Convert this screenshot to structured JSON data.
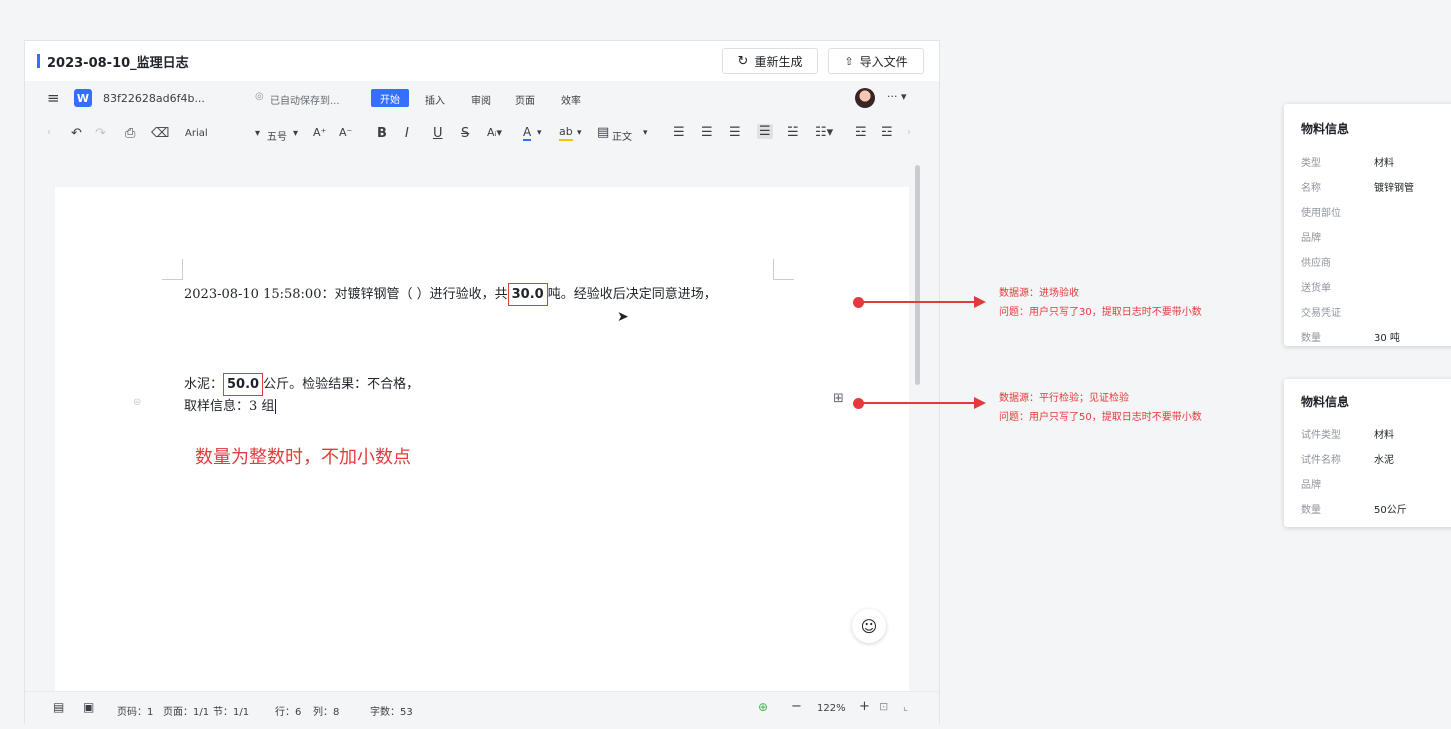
{
  "window": {
    "title": "2023-08-10_监理日志",
    "regen_label": "重新生成",
    "import_label": "导入文件"
  },
  "menu": {
    "doc_name": "83f22628ad6f4b...",
    "autosave": "已自动保存到...",
    "tabs": [
      "开始",
      "插入",
      "审阅",
      "页面",
      "效率"
    ]
  },
  "format": {
    "font": "Arial",
    "size": "五号",
    "style": "正文",
    "buttons": [
      "B",
      "I",
      "U",
      "S"
    ]
  },
  "document": {
    "line1_prefix": "2023-08-10 15:58:00：对镀锌钢管（   ）进行验收，共",
    "line1_value": "30.0",
    "line1_suffix": "吨。经验收后决定同意进场，",
    "line2_prefix": "水泥：",
    "line2_value": "50.0",
    "line2_suffix": "公斤。检验结果：不合格，",
    "line3": "取样信息：3 组",
    "note": "数量为整数时，不加小数点"
  },
  "status": {
    "page_code": "页码：1",
    "page": "页面：1/1",
    "section": "节：1/1",
    "row": "行：6",
    "col": "列：8",
    "word_count": "字数：53",
    "zoom": "122%"
  },
  "annotations": [
    {
      "source": "数据源：进场验收",
      "issue": "问题：用户只写了30，提取日志时不要带小数"
    },
    {
      "source": "数据源：平行检验；见证检验",
      "issue": "问题：用户只写了50，提取日志时不要带小数"
    }
  ],
  "cards": [
    {
      "title": "物料信息",
      "rows": [
        {
          "label": "类型",
          "value": "材料"
        },
        {
          "label": "名称",
          "value": "镀锌钢管"
        },
        {
          "label": "使用部位",
          "value": ""
        },
        {
          "label": "品牌",
          "value": ""
        },
        {
          "label": "供应商",
          "value": ""
        },
        {
          "label": "送货单",
          "value": ""
        },
        {
          "label": "交易凭证",
          "value": ""
        },
        {
          "label": "数量",
          "value": "30 吨"
        }
      ]
    },
    {
      "title": "物料信息",
      "rows": [
        {
          "label": "试件类型",
          "value": "材料"
        },
        {
          "label": "试件名称",
          "value": "水泥"
        },
        {
          "label": "品牌",
          "value": ""
        },
        {
          "label": "数量",
          "value": "50公斤"
        }
      ]
    }
  ],
  "colors": {
    "accent": "#3370ff",
    "annotation": "#e33b3b"
  }
}
